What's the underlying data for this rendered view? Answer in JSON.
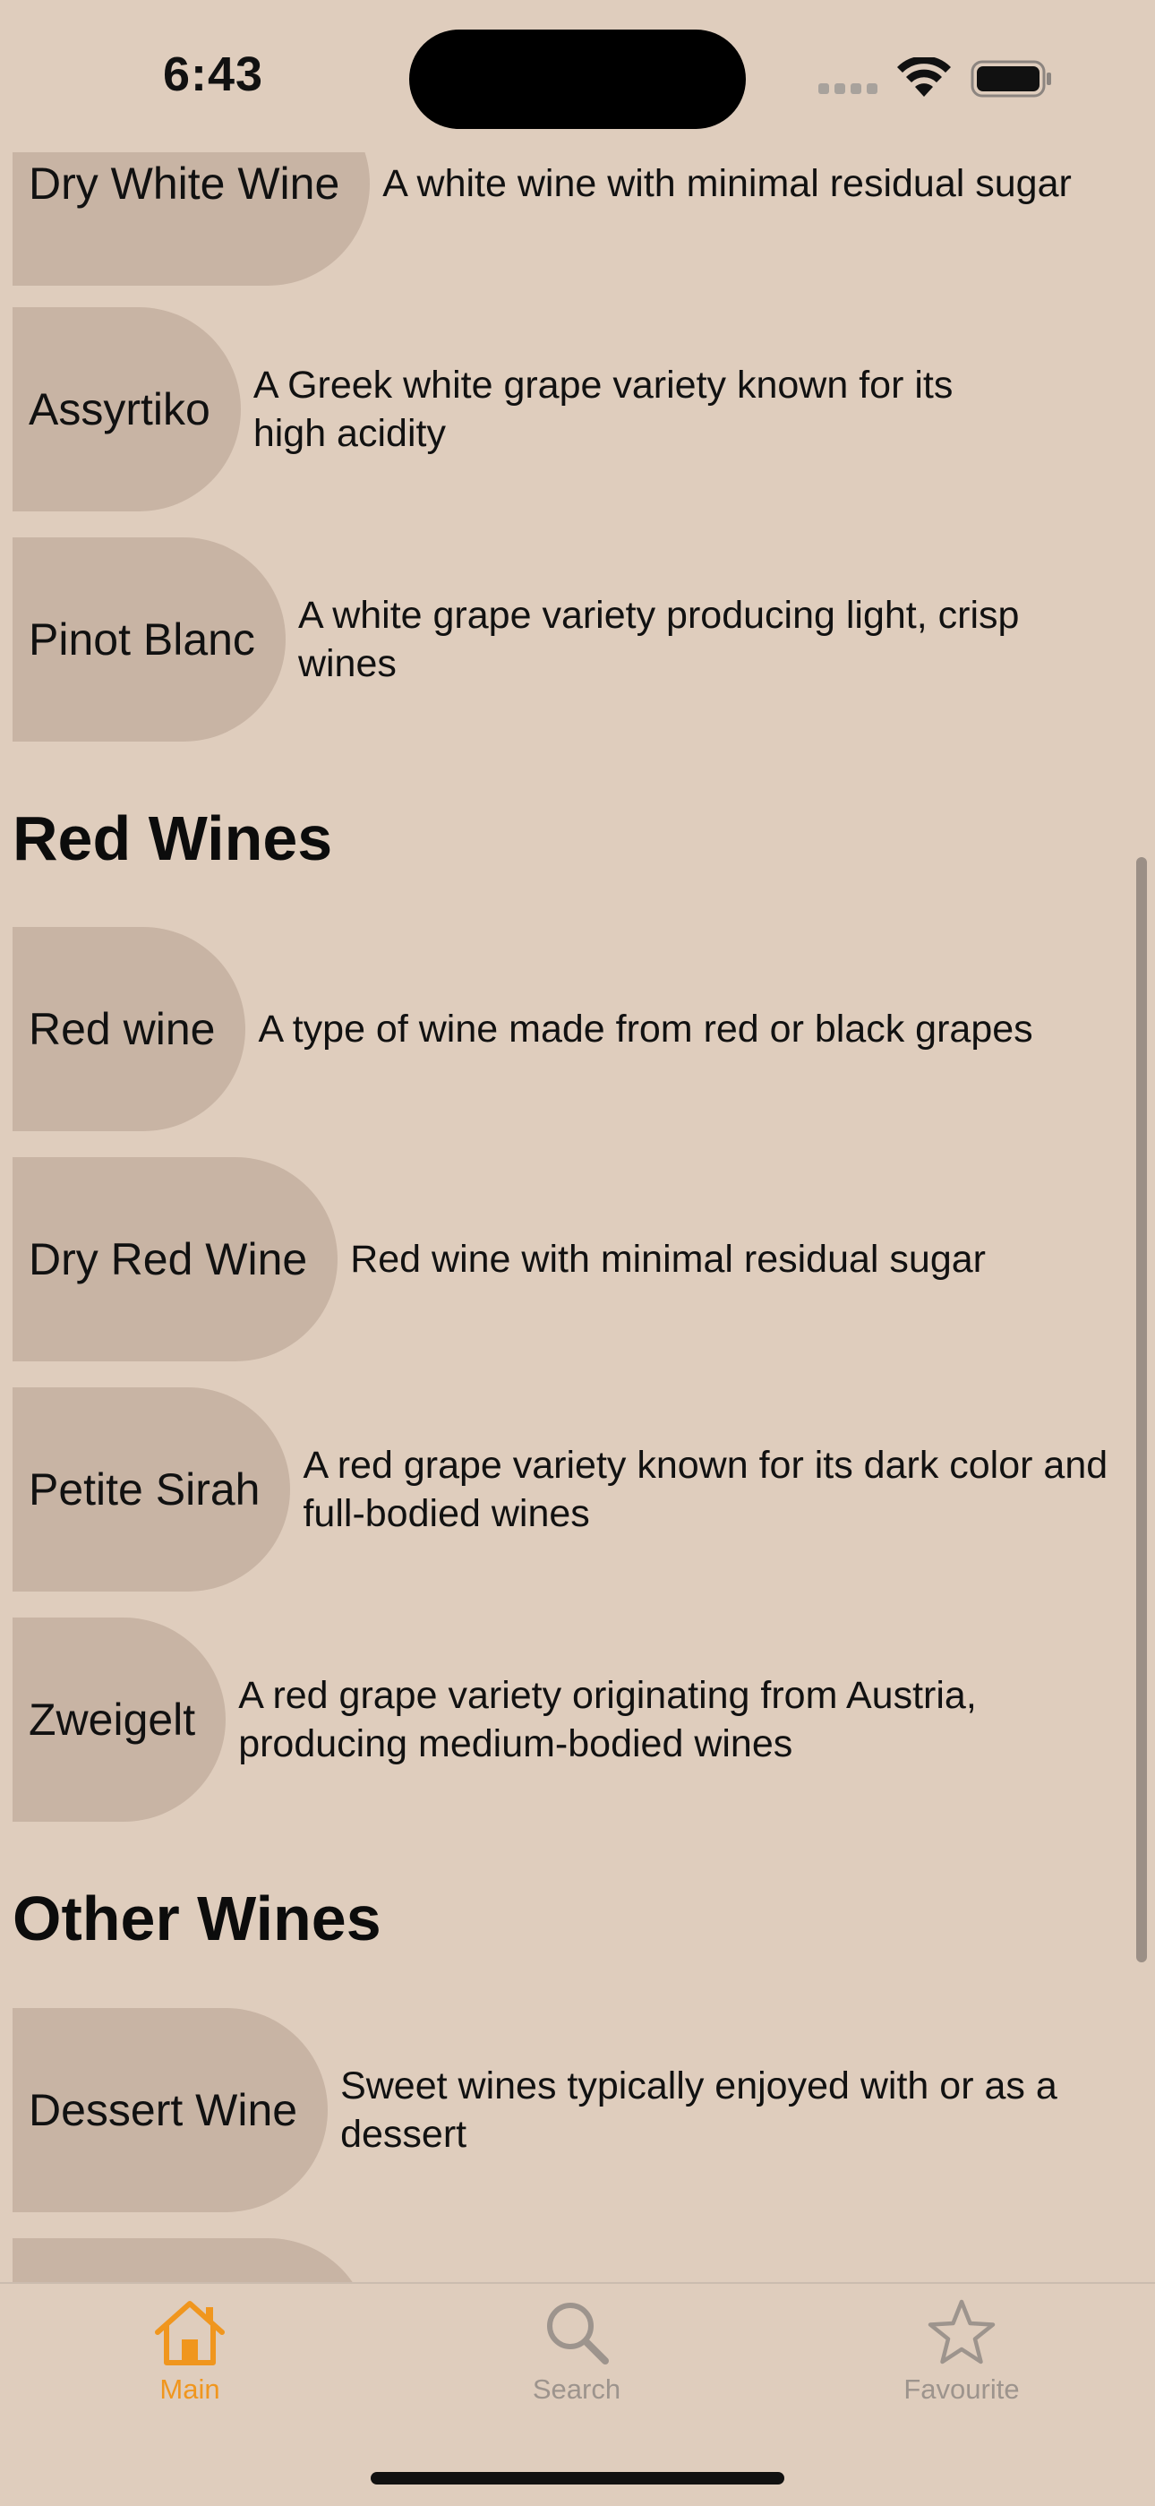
{
  "status_bar": {
    "time": "6:43"
  },
  "sections": [
    {
      "items": [
        {
          "name": "Dry White Wine",
          "description": "A white wine with minimal residual sugar"
        },
        {
          "name": "Assyrtiko",
          "description": "A Greek white grape variety known for its high acidity"
        },
        {
          "name": "Pinot Blanc",
          "description": "A white grape variety producing light, crisp wines"
        }
      ]
    },
    {
      "title": "Red Wines",
      "items": [
        {
          "name": "Red wine",
          "description": "A type of wine made from red or black grapes"
        },
        {
          "name": "Dry Red Wine",
          "description": "Red wine with minimal residual sugar"
        },
        {
          "name": "Petite Sirah",
          "description": "A red grape variety known for its dark color and full-bodied wines"
        },
        {
          "name": "Zweigelt",
          "description": "A red grape variety originating from Austria, producing medium-bodied wines"
        }
      ]
    },
    {
      "title": "Other Wines",
      "items": [
        {
          "name": "Dessert Wine",
          "description": "Sweet wines typically enjoyed with or as a dessert"
        }
      ]
    }
  ],
  "tab_bar": {
    "tabs": [
      {
        "label": "Main",
        "icon": "house-icon",
        "active": true
      },
      {
        "label": "Search",
        "icon": "magnifier-icon",
        "active": false
      },
      {
        "label": "Favourite",
        "icon": "star-icon",
        "active": false
      }
    ]
  },
  "colors": {
    "background": "#dfcdbd",
    "pill": "#c8b4a4",
    "accent": "#f0961e",
    "inactive_tab": "#9d948d"
  }
}
